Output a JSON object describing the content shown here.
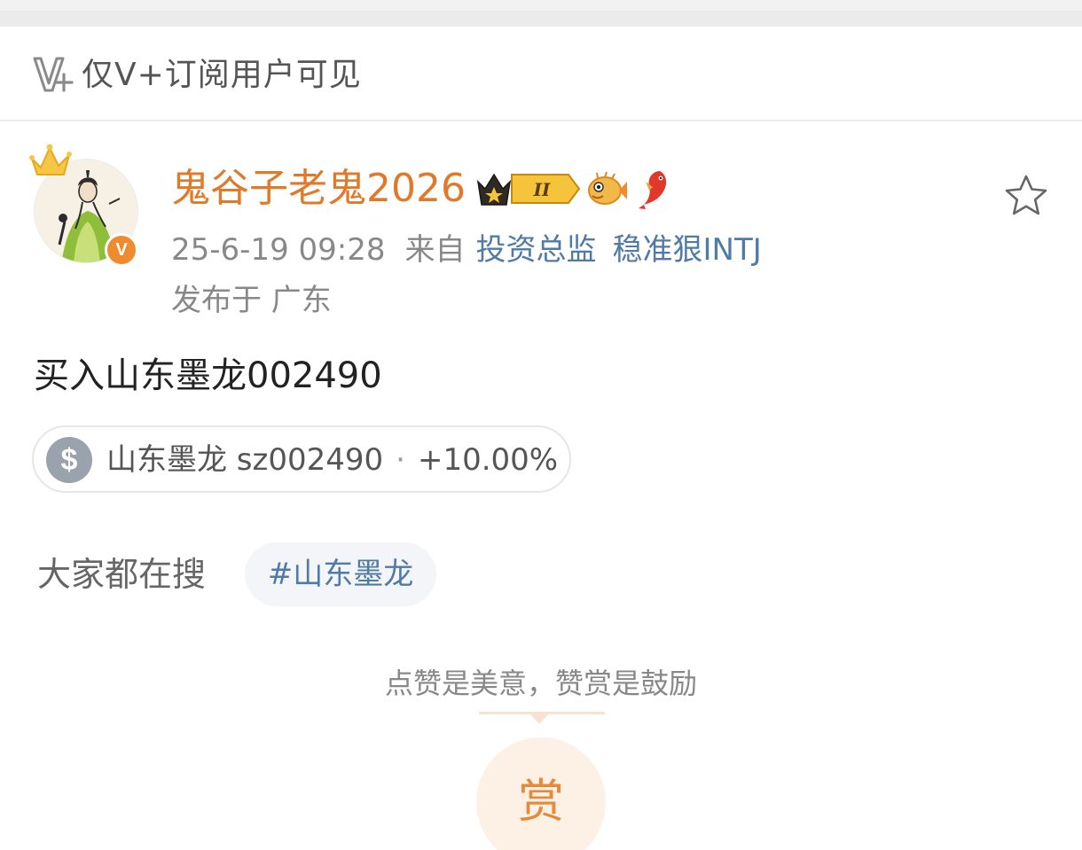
{
  "vplus_bar": {
    "label": "仅V+订阅用户可见",
    "icon": "v-plus-icon"
  },
  "post": {
    "username": "鬼谷子老鬼2026",
    "time": "25-6-19 09:28",
    "from_label": "来自",
    "source_1": "投资总监",
    "source_2": "稳准狠INTJ",
    "location": "发布于 广东",
    "text": "买入山东墨龙002490",
    "verified_letter": "V",
    "vip_level": "II",
    "colors": {
      "username": "#e07a2a",
      "link": "#4f7ba6",
      "verified": "#f08a2e"
    }
  },
  "stock_card": {
    "coin_symbol": "$",
    "name": "山东墨龙 sz002490",
    "separator": "·",
    "change": "+10.00%"
  },
  "search": {
    "label": "大家都在搜",
    "topic": "#山东墨龙"
  },
  "reward": {
    "prompt": "点赞是美意，赞赏是鼓励",
    "button_label": "赏"
  }
}
